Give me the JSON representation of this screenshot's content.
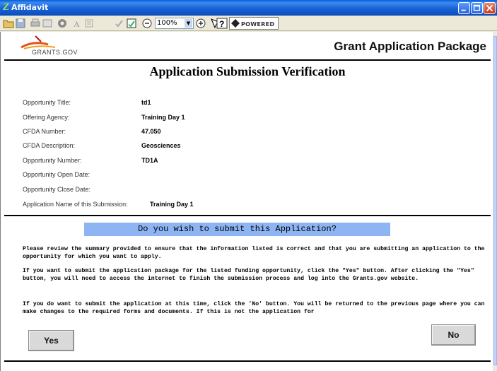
{
  "window": {
    "title": "Affidavit"
  },
  "toolbar": {
    "zoom": "100%",
    "pure_edge_label": "POWERED"
  },
  "header": {
    "logo_text": "GRANTS.GOV",
    "title": "Grant Application Package"
  },
  "page": {
    "heading": "Application Submission Verification"
  },
  "summary": [
    {
      "label": "Opportunity Title:",
      "value": "td1"
    },
    {
      "label": "Offering Agency:",
      "value": "Training Day 1"
    },
    {
      "label": "CFDA Number:",
      "value": "47.050"
    },
    {
      "label": "CFDA Description:",
      "value": "Geosciences"
    },
    {
      "label": "Opportunity Number:",
      "value": "TD1A"
    },
    {
      "label": "Opportunity Open Date:",
      "value": ""
    },
    {
      "label": "Opportunity Close Date:",
      "value": ""
    },
    {
      "label": "Application Name of this Submission:",
      "value": "Training Day 1"
    }
  ],
  "prompt": {
    "question": "Do you wish to submit this Application?",
    "paragraphs": [
      "Please review the summary provided to ensure that the information listed is correct and that you are submitting an application to the opportunity for which you want to apply.",
      "If you want to submit the application package for the listed funding opportunity, click the \"Yes\" button. After clicking the \"Yes\" button, you will need to access the internet to finish the submission process and log into the Grants.gov website.",
      "If you do want to submit the application at this time, click the 'No' button. You will be returned to the previous page where you can make changes to the required forms and documents. If this is not the application for"
    ]
  },
  "buttons": {
    "yes": "Yes",
    "no": "No"
  }
}
